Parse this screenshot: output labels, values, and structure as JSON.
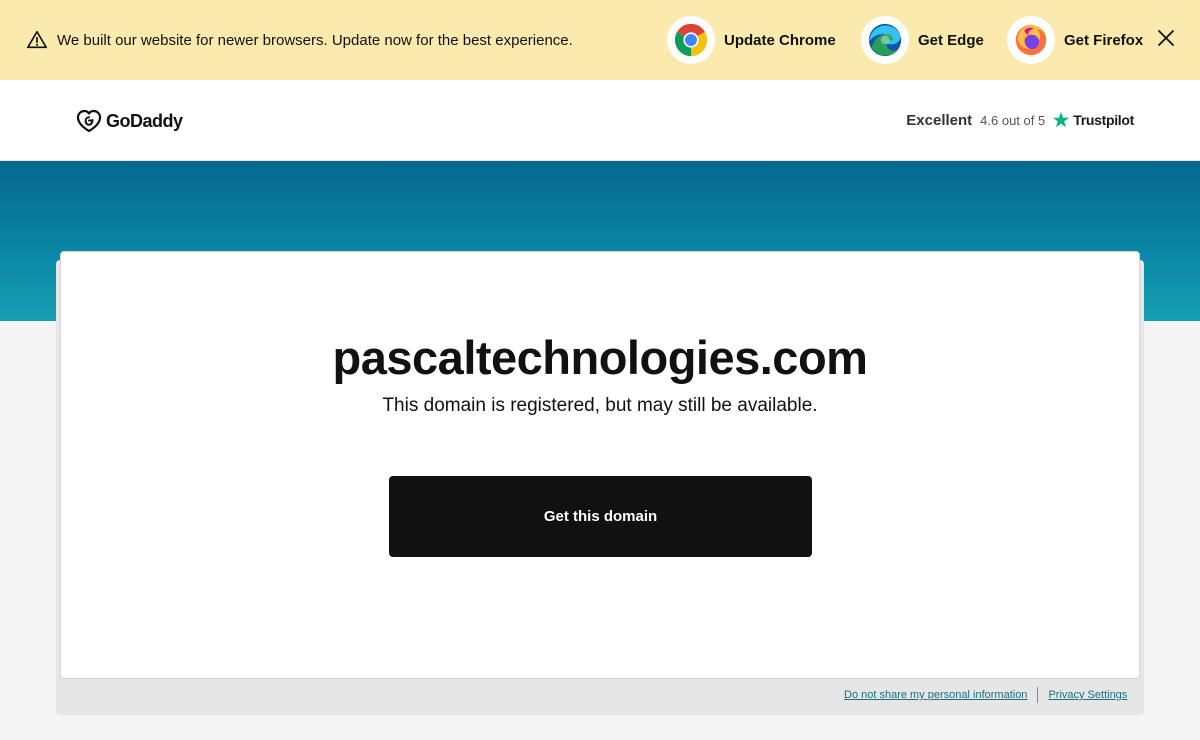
{
  "banner": {
    "message": "We built our website for newer browsers. Update now for the best experience.",
    "browsers": [
      {
        "label": "Update Chrome",
        "icon": "chrome-icon"
      },
      {
        "label": "Get Edge",
        "icon": "edge-icon"
      },
      {
        "label": "Get Firefox",
        "icon": "firefox-icon"
      }
    ],
    "close_icon": "close-icon"
  },
  "header": {
    "logo_text": "GoDaddy",
    "rating_word": "Excellent",
    "rating_score": "4.6 out of 5",
    "review_site": "Trustpilot"
  },
  "main": {
    "domain": "pascaltechnologies.com",
    "subtitle": "This domain is registered, but may still be available.",
    "cta_label": "Get this domain"
  },
  "footer": {
    "links": [
      "Do not share my personal information",
      "Privacy Settings"
    ]
  },
  "colors": {
    "banner_bg": "#fbeaae",
    "hero_top": "#05688e",
    "hero_bottom": "#169fb3",
    "cta_bg": "#111111",
    "trustpilot_star": "#00b67a",
    "link": "#1b6f7f"
  }
}
